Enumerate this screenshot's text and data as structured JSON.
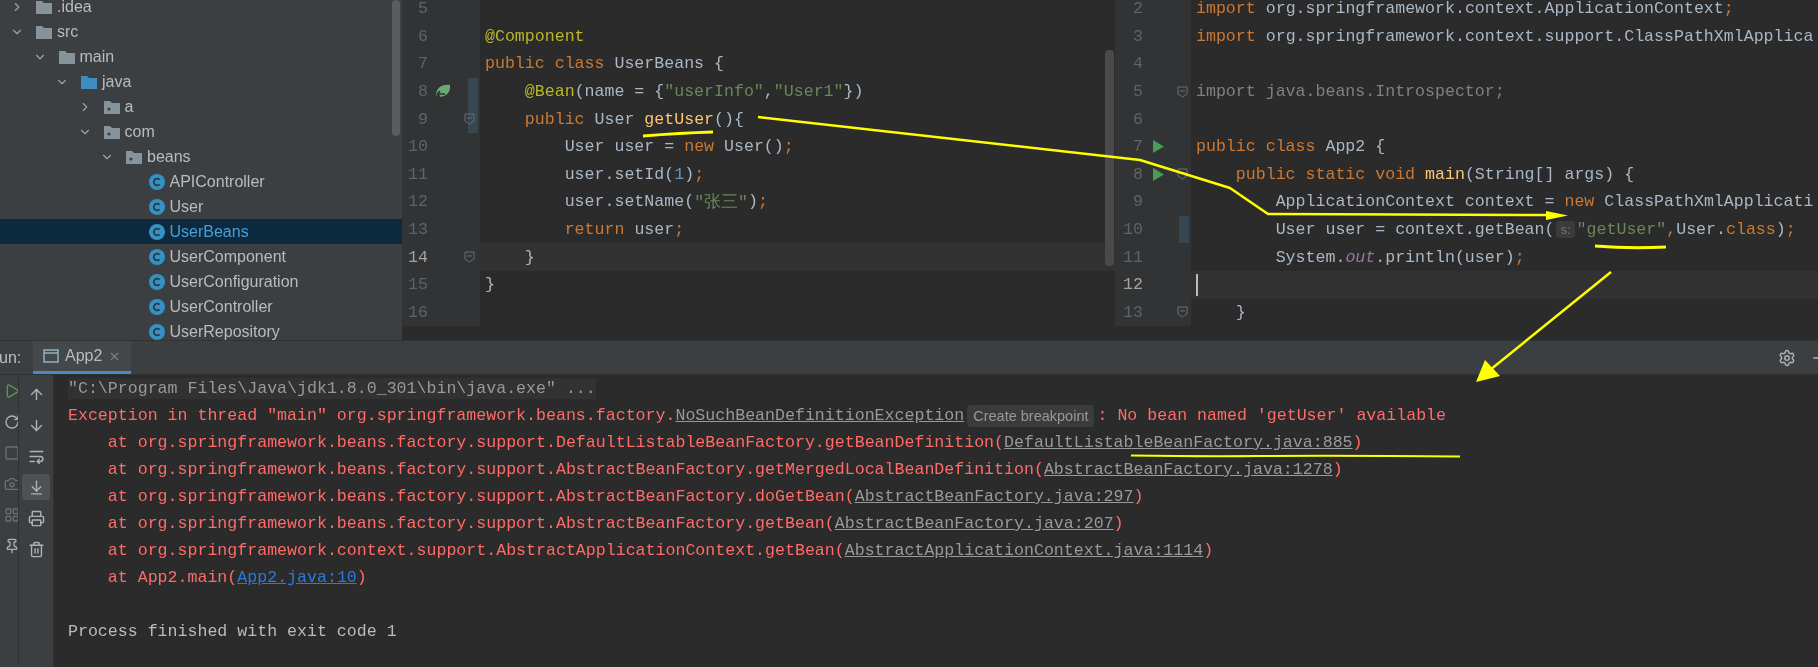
{
  "project_tree": {
    "items": [
      {
        "label": ".idea",
        "kind": "folder",
        "expanded": false,
        "selected": false
      },
      {
        "label": "src",
        "kind": "folder",
        "expanded": true,
        "selected": false,
        "children": [
          {
            "label": "main",
            "kind": "folder",
            "expanded": true,
            "selected": false,
            "children": [
              {
                "label": "java",
                "kind": "source-folder",
                "expanded": true,
                "selected": false,
                "children": [
                  {
                    "label": "a",
                    "kind": "package",
                    "expanded": false,
                    "selected": false
                  },
                  {
                    "label": "com",
                    "kind": "package",
                    "expanded": true,
                    "selected": false,
                    "children": [
                      {
                        "label": "beans",
                        "kind": "package",
                        "expanded": true,
                        "selected": false,
                        "children": [
                          {
                            "label": "APIController",
                            "kind": "class",
                            "selected": false
                          },
                          {
                            "label": "User",
                            "kind": "class",
                            "selected": false
                          },
                          {
                            "label": "UserBeans",
                            "kind": "class",
                            "selected": true
                          },
                          {
                            "label": "UserComponent",
                            "kind": "class",
                            "selected": false
                          },
                          {
                            "label": "UserConfiguration",
                            "kind": "class",
                            "selected": false
                          },
                          {
                            "label": "UserController",
                            "kind": "class",
                            "selected": false
                          },
                          {
                            "label": "UserRepository",
                            "kind": "class",
                            "selected": false
                          }
                        ]
                      }
                    ]
                  }
                ]
              }
            ]
          }
        ]
      }
    ]
  },
  "editors": [
    {
      "lines": [
        {
          "number": "5",
          "current": false
        },
        {
          "number": "6",
          "current": false,
          "tokens": [
            {
              "kind": "annotation",
              "text": "@Component"
            }
          ]
        },
        {
          "number": "7",
          "current": false,
          "tokens": [
            {
              "kind": "keyword",
              "text": "public class "
            },
            {
              "kind": "plain",
              "text": "UserBeans {"
            }
          ]
        },
        {
          "number": "8",
          "current": false,
          "gutter": {
            "kind": "bean"
          },
          "changed": true,
          "tokens": [
            {
              "kind": "annotation",
              "text": "    @Bean"
            },
            {
              "kind": "plain",
              "text": "(name = {"
            },
            {
              "kind": "string",
              "text": "\"userInfo\""
            },
            {
              "kind": "plain",
              "text": ","
            },
            {
              "kind": "string",
              "text": "\"User1\""
            },
            {
              "kind": "plain",
              "text": "})"
            }
          ]
        },
        {
          "number": "9",
          "current": false,
          "changed": true,
          "fold": true,
          "tokens": [
            {
              "kind": "keyword",
              "text": "    public "
            },
            {
              "kind": "plain",
              "text": "User "
            },
            {
              "kind": "method",
              "text": "getUser"
            },
            {
              "kind": "plain",
              "text": "(){"
            }
          ]
        },
        {
          "number": "10",
          "current": false,
          "tokens": [
            {
              "kind": "plain",
              "text": "        User user = "
            },
            {
              "kind": "keyword",
              "text": "new "
            },
            {
              "kind": "plain",
              "text": "User()"
            },
            {
              "kind": "keyword",
              "text": ";"
            }
          ]
        },
        {
          "number": "11",
          "current": false,
          "tokens": [
            {
              "kind": "plain",
              "text": "        user.setId("
            },
            {
              "kind": "number",
              "text": "1"
            },
            {
              "kind": "plain",
              "text": ")"
            },
            {
              "kind": "keyword",
              "text": ";"
            }
          ]
        },
        {
          "number": "12",
          "current": false,
          "tokens": [
            {
              "kind": "plain",
              "text": "        user.setName("
            },
            {
              "kind": "string",
              "text": "\"张三\""
            },
            {
              "kind": "plain",
              "text": ")"
            },
            {
              "kind": "keyword",
              "text": ";"
            }
          ]
        },
        {
          "number": "13",
          "current": false,
          "tokens": [
            {
              "kind": "keyword",
              "text": "        return "
            },
            {
              "kind": "plain",
              "text": "user"
            },
            {
              "kind": "keyword",
              "text": ";"
            }
          ]
        },
        {
          "number": "14",
          "current": true,
          "fold": true,
          "tokens": [
            {
              "kind": "plain",
              "text": "    }"
            }
          ]
        },
        {
          "number": "15",
          "current": false,
          "tokens": [
            {
              "kind": "plain",
              "text": "}"
            }
          ]
        },
        {
          "number": "16",
          "current": false
        }
      ]
    },
    {
      "lines": [
        {
          "number": "2",
          "current": false,
          "tokens": [
            {
              "kind": "keyword",
              "text": "import "
            },
            {
              "kind": "plain",
              "text": "org.springframework.context.ApplicationContext"
            },
            {
              "kind": "keyword",
              "text": ";"
            }
          ]
        },
        {
          "number": "3",
          "current": false,
          "tokens": [
            {
              "kind": "keyword",
              "text": "import "
            },
            {
              "kind": "plain",
              "text": "org.springframework.context.support.ClassPathXmlApplica"
            }
          ]
        },
        {
          "number": "4",
          "current": false
        },
        {
          "number": "5",
          "current": false,
          "fold": true,
          "tokens": [
            {
              "kind": "unused",
              "text": "import java.beans.Introspector;"
            }
          ]
        },
        {
          "number": "6",
          "current": false
        },
        {
          "number": "7",
          "current": false,
          "gutter": {
            "kind": "run"
          },
          "tokens": [
            {
              "kind": "keyword",
              "text": "public class "
            },
            {
              "kind": "plain",
              "text": "App2 {"
            }
          ]
        },
        {
          "number": "8",
          "current": false,
          "gutter": {
            "kind": "run"
          },
          "fold": true,
          "tokens": [
            {
              "kind": "keyword",
              "text": "    public static void "
            },
            {
              "kind": "method",
              "text": "main"
            },
            {
              "kind": "plain",
              "text": "(String[] args) {"
            }
          ]
        },
        {
          "number": "9",
          "current": false,
          "tokens": [
            {
              "kind": "plain",
              "text": "        ApplicationContext context = "
            },
            {
              "kind": "keyword",
              "text": "new "
            },
            {
              "kind": "plain",
              "text": "ClassPathXmlApplicati"
            }
          ]
        },
        {
          "number": "10",
          "current": false,
          "changed": true,
          "tokens": [
            {
              "kind": "plain",
              "text": "        User user = context.getBean("
            },
            {
              "kind": "hint",
              "text": "s:"
            },
            {
              "kind": "string",
              "text": "\"getUser\""
            },
            {
              "kind": "keyword",
              "text": ","
            },
            {
              "kind": "plain",
              "text": "User."
            },
            {
              "kind": "keyword",
              "text": "class"
            },
            {
              "kind": "plain",
              "text": ")"
            },
            {
              "kind": "keyword",
              "text": ";"
            }
          ]
        },
        {
          "number": "11",
          "current": false,
          "tokens": [
            {
              "kind": "plain",
              "text": "        System."
            },
            {
              "kind": "field",
              "text": "out"
            },
            {
              "kind": "plain",
              "text": ".println(user)"
            },
            {
              "kind": "keyword",
              "text": ";"
            }
          ]
        },
        {
          "number": "12",
          "current": true,
          "cursor": true
        },
        {
          "number": "13",
          "current": false,
          "fold": true,
          "tokens": [
            {
              "kind": "plain",
              "text": "    }"
            }
          ]
        }
      ]
    }
  ],
  "run_panel": {
    "label": "un:",
    "tabs": [
      {
        "label": "App2",
        "selected": true
      }
    ],
    "toolbar": [
      {
        "kind": "up",
        "on": false
      },
      {
        "kind": "down",
        "on": false
      },
      {
        "kind": "wrap",
        "on": false
      },
      {
        "kind": "scroll-end",
        "on": true
      },
      {
        "kind": "print",
        "on": false
      },
      {
        "kind": "trash",
        "on": false
      }
    ],
    "lines": [
      {
        "segments": [
          {
            "kind": "command",
            "text": "\"C:\\Program Files\\Java\\jdk1.8.0_301\\bin\\java.exe\" ..."
          }
        ]
      },
      {
        "segments": [
          {
            "kind": "error",
            "text": "Exception in thread \"main\" org.springframework.beans.factory."
          },
          {
            "kind": "link",
            "text": "NoSuchBeanDefinitionException"
          },
          {
            "kind": "button",
            "text": "Create breakpoint"
          },
          {
            "kind": "error",
            "text": ": No bean named 'getUser' available"
          }
        ]
      },
      {
        "segments": [
          {
            "kind": "error",
            "text": "    at org.springframework.beans.factory.support.DefaultListableBeanFactory.getBeanDefinition("
          },
          {
            "kind": "link",
            "text": "DefaultListableBeanFactory.java:885"
          },
          {
            "kind": "error",
            "text": ")"
          }
        ]
      },
      {
        "segments": [
          {
            "kind": "error",
            "text": "    at org.springframework.beans.factory.support.AbstractBeanFactory.getMergedLocalBeanDefinition("
          },
          {
            "kind": "link",
            "text": "AbstractBeanFactory.java:1278"
          },
          {
            "kind": "error",
            "text": ")"
          }
        ]
      },
      {
        "segments": [
          {
            "kind": "error",
            "text": "    at org.springframework.beans.factory.support.AbstractBeanFactory.doGetBean("
          },
          {
            "kind": "link",
            "text": "AbstractBeanFactory.java:297"
          },
          {
            "kind": "error",
            "text": ")"
          }
        ]
      },
      {
        "segments": [
          {
            "kind": "error",
            "text": "    at org.springframework.beans.factory.support.AbstractBeanFactory.getBean("
          },
          {
            "kind": "link",
            "text": "AbstractBeanFactory.java:207"
          },
          {
            "kind": "error",
            "text": ")"
          }
        ]
      },
      {
        "segments": [
          {
            "kind": "error",
            "text": "    at org.springframework.context.support.AbstractApplicationContext.getBean("
          },
          {
            "kind": "link",
            "text": "AbstractApplicationContext.java:1114"
          },
          {
            "kind": "error",
            "text": ")"
          }
        ]
      },
      {
        "segments": [
          {
            "kind": "error",
            "text": "    at App2.main("
          },
          {
            "kind": "app-link",
            "text": "App2.java:10"
          },
          {
            "kind": "error",
            "text": ")"
          }
        ]
      }
    ],
    "exit_message": "Process finished with exit code 1"
  }
}
